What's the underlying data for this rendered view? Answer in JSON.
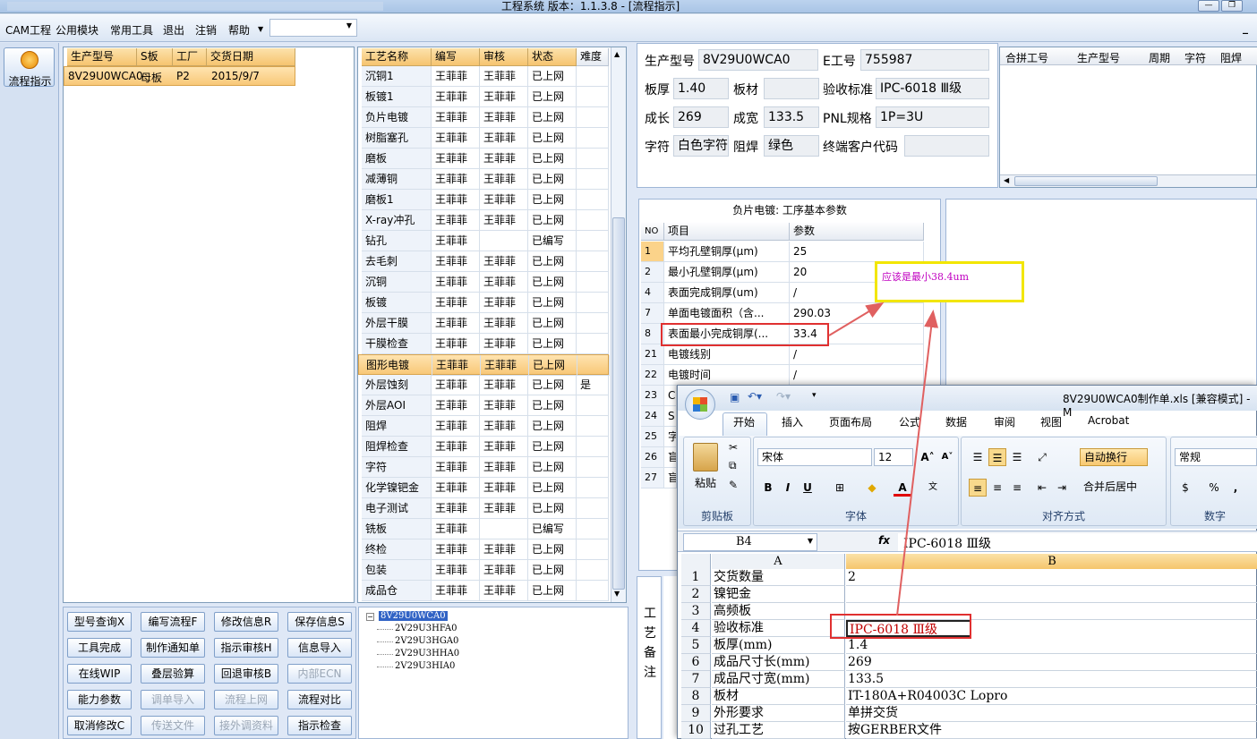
{
  "window": {
    "title": "工程系统   版本：1.1.3.8 - [流程指示]"
  },
  "menu": {
    "items": [
      "CAM工程",
      "公用模块",
      "常用工具",
      "退出",
      "注销",
      "帮助"
    ]
  },
  "left_nav": {
    "flow_label": "流程指示"
  },
  "product_grid": {
    "headers": [
      "生产型号",
      "S板",
      "工厂",
      "交货日期"
    ],
    "row": [
      "8V29U0WCA0",
      "母板",
      "P2",
      "2015/9/7"
    ]
  },
  "process_grid": {
    "headers": [
      "工艺名称",
      "编写",
      "审核",
      "状态",
      "难度"
    ],
    "rows": [
      [
        "沉铜1",
        "王菲菲",
        "王菲菲",
        "已上网",
        ""
      ],
      [
        "板镀1",
        "王菲菲",
        "王菲菲",
        "已上网",
        ""
      ],
      [
        "负片电镀",
        "王菲菲",
        "王菲菲",
        "已上网",
        ""
      ],
      [
        "树脂塞孔",
        "王菲菲",
        "王菲菲",
        "已上网",
        ""
      ],
      [
        "磨板",
        "王菲菲",
        "王菲菲",
        "已上网",
        ""
      ],
      [
        "减薄铜",
        "王菲菲",
        "王菲菲",
        "已上网",
        ""
      ],
      [
        "磨板1",
        "王菲菲",
        "王菲菲",
        "已上网",
        ""
      ],
      [
        "X-ray冲孔",
        "王菲菲",
        "王菲菲",
        "已上网",
        ""
      ],
      [
        "钻孔",
        "王菲菲",
        "",
        "已编写",
        ""
      ],
      [
        "去毛刺",
        "王菲菲",
        "王菲菲",
        "已上网",
        ""
      ],
      [
        "沉铜",
        "王菲菲",
        "王菲菲",
        "已上网",
        ""
      ],
      [
        "板镀",
        "王菲菲",
        "王菲菲",
        "已上网",
        ""
      ],
      [
        "外层干膜",
        "王菲菲",
        "王菲菲",
        "已上网",
        ""
      ],
      [
        "干膜检查",
        "王菲菲",
        "王菲菲",
        "已上网",
        ""
      ],
      [
        "图形电镀",
        "王菲菲",
        "王菲菲",
        "已上网",
        ""
      ],
      [
        "外层蚀刻",
        "王菲菲",
        "王菲菲",
        "已上网",
        "是"
      ],
      [
        "外层AOI",
        "王菲菲",
        "王菲菲",
        "已上网",
        ""
      ],
      [
        "阻焊",
        "王菲菲",
        "王菲菲",
        "已上网",
        ""
      ],
      [
        "阻焊检查",
        "王菲菲",
        "王菲菲",
        "已上网",
        ""
      ],
      [
        "字符",
        "王菲菲",
        "王菲菲",
        "已上网",
        ""
      ],
      [
        "化学镍钯金",
        "王菲菲",
        "王菲菲",
        "已上网",
        ""
      ],
      [
        "电子测试",
        "王菲菲",
        "王菲菲",
        "已上网",
        ""
      ],
      [
        "铣板",
        "王菲菲",
        "",
        "已编写",
        ""
      ],
      [
        "终检",
        "王菲菲",
        "王菲菲",
        "已上网",
        ""
      ],
      [
        "包装",
        "王菲菲",
        "王菲菲",
        "已上网",
        ""
      ],
      [
        "成品仓",
        "王菲菲",
        "王菲菲",
        "已上网",
        ""
      ]
    ]
  },
  "buttons": [
    [
      "型号查询X",
      "编写流程F",
      "修改信息R",
      "保存信息S"
    ],
    [
      "工具完成",
      "制作通知单",
      "指示审核H",
      "信息导入"
    ],
    [
      "在线WIP",
      "叠层验算",
      "回退审核B",
      "内部ECN"
    ],
    [
      "能力参数",
      "调单导入",
      "流程上网",
      "流程对比"
    ],
    [
      "取消修改C",
      "传送文件",
      "接外调资料",
      "指示检查"
    ]
  ],
  "tree": {
    "root": "8V29U0WCA0",
    "children": [
      "2V29U3HFA0",
      "2V29U3HGA0",
      "2V29U3HHA0",
      "2V29U3HIA0"
    ]
  },
  "info": {
    "labels": {
      "model": "生产型号",
      "eno": "E工号",
      "thick": "板厚",
      "material": "板材",
      "standard": "验收标准",
      "len": "成长",
      "wid": "成宽",
      "pnl": "PNL规格",
      "char": "字符",
      "mask": "阻焊",
      "customer": "终端客户代码"
    },
    "values": {
      "model": "8V29U0WCA0",
      "eno": "755987",
      "thick": "1.40",
      "material": "",
      "standard": "IPC-6018 Ⅲ级",
      "len": "269",
      "wid": "133.5",
      "pnl": "1P=3U",
      "char": "白色字符",
      "mask": "绿色",
      "customer": ""
    }
  },
  "combine_grid": {
    "headers": [
      "合拼工号",
      "生产型号",
      "周期",
      "字符",
      "阻焊"
    ]
  },
  "param_panel": {
    "title": "负片电镀: 工序基本参数",
    "headers": [
      "NO",
      "项目",
      "参数"
    ],
    "rows": [
      [
        "1",
        "平均孔壁铜厚(μm)",
        "25"
      ],
      [
        "2",
        "最小孔壁铜厚(μm)",
        "20"
      ],
      [
        "4",
        "表面完成铜厚(um)",
        "/"
      ],
      [
        "7",
        "单面电镀面积（含...",
        "290.03"
      ],
      [
        "8",
        "表面最小完成铜厚(...",
        "33.4"
      ],
      [
        "21",
        "电镀线别",
        "/"
      ],
      [
        "22",
        "电镀时间",
        "/"
      ]
    ],
    "partial_nums": [
      "23",
      "24",
      "25",
      "26",
      "27"
    ],
    "partial_labels": [
      "C",
      "S",
      "字",
      "盲",
      "盲"
    ]
  },
  "side_label": [
    "工",
    "艺",
    "备",
    "注"
  ],
  "annotation": {
    "text": "应该是最小38.4um"
  },
  "excel": {
    "title": "8V29U0WCA0制作单.xls  [兼容模式] - M",
    "tabs": [
      "开始",
      "插入",
      "页面布局",
      "公式",
      "数据",
      "审阅",
      "视图",
      "Acrobat"
    ],
    "font_name": "宋体",
    "font_size": "12",
    "wrap": "自动换行",
    "merge": "合并后居中",
    "number_format": "常规",
    "groups": [
      "剪贴板",
      "字体",
      "对齐方式",
      "数字"
    ],
    "paste": "粘贴",
    "cell_ref": "B4",
    "formula": "IPC-6018  Ⅲ级",
    "cols": [
      "A",
      "B"
    ],
    "rows": [
      [
        "1",
        "交货数量",
        "2"
      ],
      [
        "2",
        "镍钯金",
        ""
      ],
      [
        "3",
        "高频板",
        ""
      ],
      [
        "4",
        "验收标准",
        "IPC-6018  Ⅲ级"
      ],
      [
        "5",
        "板厚(mm)",
        "1.4"
      ],
      [
        "6",
        "成品尺寸长(mm)",
        "269"
      ],
      [
        "7",
        "成品尺寸宽(mm)",
        "133.5"
      ],
      [
        "8",
        "板材",
        "IT-180A+R04003C Lopro"
      ],
      [
        "9",
        "外形要求",
        "单拼交货"
      ],
      [
        "10",
        "过孔工艺",
        "按GERBER文件"
      ]
    ]
  },
  "colors": {
    "highlight": "#f8c878",
    "annotation_border": "#f2e600",
    "annotation_text": "#c000c0",
    "red_box": "#e03030"
  }
}
